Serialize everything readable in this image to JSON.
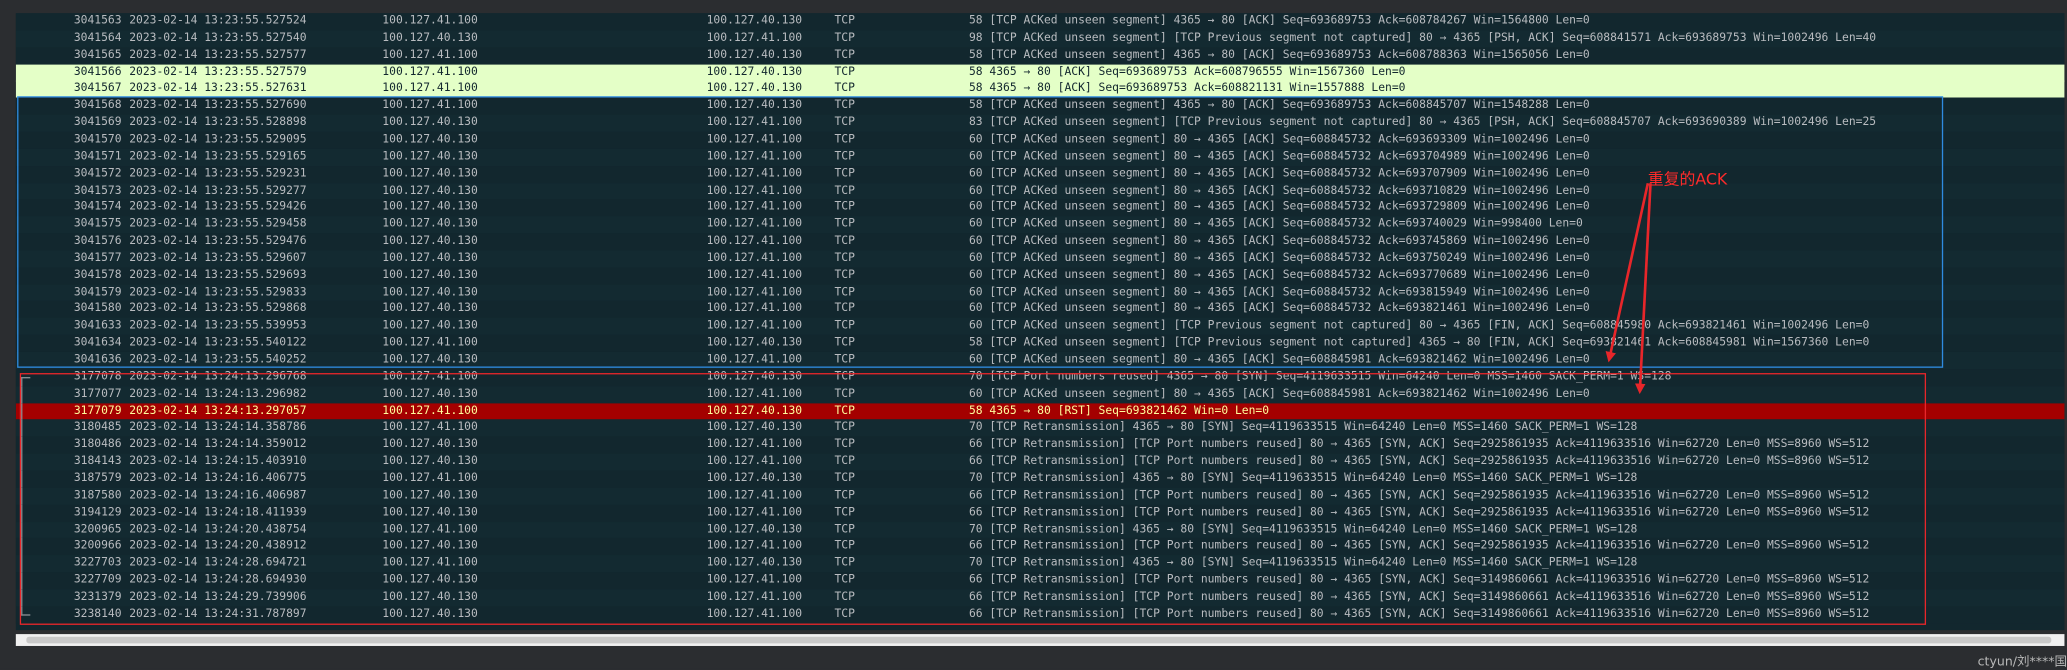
{
  "colors": {
    "list_background": "#12272e",
    "default_text": "#b9bcc0",
    "highlight_row_bg": "#e4ffc7",
    "rst_row_bg": "#a40000",
    "rst_row_text": "#fffc9c",
    "blue_box": "#2f8be0",
    "red_box_and_annotation": "#e8262a"
  },
  "annotation": {
    "label": "重复的ACK"
  },
  "watermark": "ctyun/刘****国",
  "packets": [
    {
      "no": "3041563",
      "time": "2023-02-14 13:23:55.527524",
      "src": "100.127.41.100",
      "dst": "100.127.40.130",
      "proto": "TCP",
      "info": "58 [TCP ACKed unseen segment] 4365 → 80 [ACK] Seq=693689753 Ack=608784267 Win=1564800 Len=0",
      "style": "even",
      "conv": ""
    },
    {
      "no": "3041564",
      "time": "2023-02-14 13:23:55.527540",
      "src": "100.127.40.130",
      "dst": "100.127.41.100",
      "proto": "TCP",
      "info": "98 [TCP ACKed unseen segment] [TCP Previous segment not captured] 80 → 4365 [PSH, ACK] Seq=608841571 Ack=693689753 Win=1002496 Len=40",
      "style": "odd",
      "conv": ""
    },
    {
      "no": "3041565",
      "time": "2023-02-14 13:23:55.527577",
      "src": "100.127.41.100",
      "dst": "100.127.40.130",
      "proto": "TCP",
      "info": "58 [TCP ACKed unseen segment] 4365 → 80 [ACK] Seq=693689753 Ack=608788363 Win=1565056 Len=0",
      "style": "even",
      "conv": ""
    },
    {
      "no": "3041566",
      "time": "2023-02-14 13:23:55.527579",
      "src": "100.127.41.100",
      "dst": "100.127.40.130",
      "proto": "TCP",
      "info": "58 4365 → 80 [ACK] Seq=693689753 Ack=608796555 Win=1567360 Len=0",
      "style": "highlight",
      "conv": ""
    },
    {
      "no": "3041567",
      "time": "2023-02-14 13:23:55.527631",
      "src": "100.127.41.100",
      "dst": "100.127.40.130",
      "proto": "TCP",
      "info": "58 4365 → 80 [ACK] Seq=693689753 Ack=608821131 Win=1557888 Len=0",
      "style": "highlight",
      "conv": ""
    },
    {
      "no": "3041568",
      "time": "2023-02-14 13:23:55.527690",
      "src": "100.127.41.100",
      "dst": "100.127.40.130",
      "proto": "TCP",
      "info": "58 [TCP ACKed unseen segment] 4365 → 80 [ACK] Seq=693689753 Ack=608845707 Win=1548288 Len=0",
      "style": "even",
      "conv": ""
    },
    {
      "no": "3041569",
      "time": "2023-02-14 13:23:55.528898",
      "src": "100.127.40.130",
      "dst": "100.127.41.100",
      "proto": "TCP",
      "info": "83 [TCP ACKed unseen segment] [TCP Previous segment not captured] 80 → 4365 [PSH, ACK] Seq=608845707 Ack=693690389 Win=1002496 Len=25",
      "style": "odd",
      "conv": ""
    },
    {
      "no": "3041570",
      "time": "2023-02-14 13:23:55.529095",
      "src": "100.127.40.130",
      "dst": "100.127.41.100",
      "proto": "TCP",
      "info": "60 [TCP ACKed unseen segment] 80 → 4365 [ACK] Seq=608845732 Ack=693693309 Win=1002496 Len=0",
      "style": "even",
      "conv": ""
    },
    {
      "no": "3041571",
      "time": "2023-02-14 13:23:55.529165",
      "src": "100.127.40.130",
      "dst": "100.127.41.100",
      "proto": "TCP",
      "info": "60 [TCP ACKed unseen segment] 80 → 4365 [ACK] Seq=608845732 Ack=693704989 Win=1002496 Len=0",
      "style": "odd",
      "conv": ""
    },
    {
      "no": "3041572",
      "time": "2023-02-14 13:23:55.529231",
      "src": "100.127.40.130",
      "dst": "100.127.41.100",
      "proto": "TCP",
      "info": "60 [TCP ACKed unseen segment] 80 → 4365 [ACK] Seq=608845732 Ack=693707909 Win=1002496 Len=0",
      "style": "even",
      "conv": ""
    },
    {
      "no": "3041573",
      "time": "2023-02-14 13:23:55.529277",
      "src": "100.127.40.130",
      "dst": "100.127.41.100",
      "proto": "TCP",
      "info": "60 [TCP ACKed unseen segment] 80 → 4365 [ACK] Seq=608845732 Ack=693710829 Win=1002496 Len=0",
      "style": "odd",
      "conv": ""
    },
    {
      "no": "3041574",
      "time": "2023-02-14 13:23:55.529426",
      "src": "100.127.40.130",
      "dst": "100.127.41.100",
      "proto": "TCP",
      "info": "60 [TCP ACKed unseen segment] 80 → 4365 [ACK] Seq=608845732 Ack=693729809 Win=1002496 Len=0",
      "style": "even",
      "conv": ""
    },
    {
      "no": "3041575",
      "time": "2023-02-14 13:23:55.529458",
      "src": "100.127.40.130",
      "dst": "100.127.41.100",
      "proto": "TCP",
      "info": "60 [TCP ACKed unseen segment] 80 → 4365 [ACK] Seq=608845732 Ack=693740029 Win=998400 Len=0",
      "style": "odd",
      "conv": ""
    },
    {
      "no": "3041576",
      "time": "2023-02-14 13:23:55.529476",
      "src": "100.127.40.130",
      "dst": "100.127.41.100",
      "proto": "TCP",
      "info": "60 [TCP ACKed unseen segment] 80 → 4365 [ACK] Seq=608845732 Ack=693745869 Win=1002496 Len=0",
      "style": "even",
      "conv": ""
    },
    {
      "no": "3041577",
      "time": "2023-02-14 13:23:55.529607",
      "src": "100.127.40.130",
      "dst": "100.127.41.100",
      "proto": "TCP",
      "info": "60 [TCP ACKed unseen segment] 80 → 4365 [ACK] Seq=608845732 Ack=693750249 Win=1002496 Len=0",
      "style": "odd",
      "conv": ""
    },
    {
      "no": "3041578",
      "time": "2023-02-14 13:23:55.529693",
      "src": "100.127.40.130",
      "dst": "100.127.41.100",
      "proto": "TCP",
      "info": "60 [TCP ACKed unseen segment] 80 → 4365 [ACK] Seq=608845732 Ack=693770689 Win=1002496 Len=0",
      "style": "even",
      "conv": ""
    },
    {
      "no": "3041579",
      "time": "2023-02-14 13:23:55.529833",
      "src": "100.127.40.130",
      "dst": "100.127.41.100",
      "proto": "TCP",
      "info": "60 [TCP ACKed unseen segment] 80 → 4365 [ACK] Seq=608845732 Ack=693815949 Win=1002496 Len=0",
      "style": "odd",
      "conv": ""
    },
    {
      "no": "3041580",
      "time": "2023-02-14 13:23:55.529868",
      "src": "100.127.40.130",
      "dst": "100.127.41.100",
      "proto": "TCP",
      "info": "60 [TCP ACKed unseen segment] 80 → 4365 [ACK] Seq=608845732 Ack=693821461 Win=1002496 Len=0",
      "style": "even",
      "conv": ""
    },
    {
      "no": "3041633",
      "time": "2023-02-14 13:23:55.539953",
      "src": "100.127.40.130",
      "dst": "100.127.41.100",
      "proto": "TCP",
      "info": "60 [TCP ACKed unseen segment] [TCP Previous segment not captured] 80 → 4365 [FIN, ACK] Seq=608845980 Ack=693821461 Win=1002496 Len=0",
      "style": "odd",
      "conv": ""
    },
    {
      "no": "3041634",
      "time": "2023-02-14 13:23:55.540122",
      "src": "100.127.41.100",
      "dst": "100.127.40.130",
      "proto": "TCP",
      "info": "58 [TCP ACKed unseen segment] [TCP Previous segment not captured] 4365 → 80 [FIN, ACK] Seq=693821461 Ack=608845981 Win=1567360 Len=0",
      "style": "even",
      "conv": ""
    },
    {
      "no": "3041636",
      "time": "2023-02-14 13:23:55.540252",
      "src": "100.127.40.130",
      "dst": "100.127.41.100",
      "proto": "TCP",
      "info": "60 [TCP ACKed unseen segment] 80 → 4365 [ACK] Seq=608845981 Ack=693821462 Win=1002496 Len=0",
      "style": "odd",
      "conv": ""
    },
    {
      "no": "3177078",
      "time": "2023-02-14 13:24:13.296768",
      "src": "100.127.41.100",
      "dst": "100.127.40.130",
      "proto": "TCP",
      "info": "70 [TCP Port numbers reused] 4365 → 80 [SYN] Seq=4119633515 Win=64240 Len=0 MSS=1460 SACK_PERM=1 WS=128",
      "style": "even",
      "conv": "start"
    },
    {
      "no": "3177077",
      "time": "2023-02-14 13:24:13.296982",
      "src": "100.127.40.130",
      "dst": "100.127.41.100",
      "proto": "TCP",
      "info": "60 [TCP ACKed unseen segment] 80 → 4365 [ACK] Seq=608845981 Ack=693821462 Win=1002496 Len=0",
      "style": "odd",
      "conv": "line"
    },
    {
      "no": "3177079",
      "time": "2023-02-14 13:24:13.297057",
      "src": "100.127.41.100",
      "dst": "100.127.40.130",
      "proto": "TCP",
      "info": "58 4365 → 80 [RST] Seq=693821462 Win=0 Len=0",
      "style": "rst",
      "conv": "line"
    },
    {
      "no": "3180485",
      "time": "2023-02-14 13:24:14.358786",
      "src": "100.127.41.100",
      "dst": "100.127.40.130",
      "proto": "TCP",
      "info": "70 [TCP Retransmission] 4365 → 80 [SYN] Seq=4119633515 Win=64240 Len=0 MSS=1460 SACK_PERM=1 WS=128",
      "style": "odd",
      "conv": "line"
    },
    {
      "no": "3180486",
      "time": "2023-02-14 13:24:14.359012",
      "src": "100.127.40.130",
      "dst": "100.127.41.100",
      "proto": "TCP",
      "info": "66 [TCP Retransmission] [TCP Port numbers reused] 80 → 4365 [SYN, ACK] Seq=2925861935 Ack=4119633516 Win=62720 Len=0 MSS=8960 WS=512",
      "style": "even",
      "conv": "line"
    },
    {
      "no": "3184143",
      "time": "2023-02-14 13:24:15.403910",
      "src": "100.127.40.130",
      "dst": "100.127.41.100",
      "proto": "TCP",
      "info": "66 [TCP Retransmission] [TCP Port numbers reused] 80 → 4365 [SYN, ACK] Seq=2925861935 Ack=4119633516 Win=62720 Len=0 MSS=8960 WS=512",
      "style": "odd",
      "conv": "line"
    },
    {
      "no": "3187579",
      "time": "2023-02-14 13:24:16.406775",
      "src": "100.127.41.100",
      "dst": "100.127.40.130",
      "proto": "TCP",
      "info": "70 [TCP Retransmission] 4365 → 80 [SYN] Seq=4119633515 Win=64240 Len=0 MSS=1460 SACK_PERM=1 WS=128",
      "style": "even",
      "conv": "line"
    },
    {
      "no": "3187580",
      "time": "2023-02-14 13:24:16.406987",
      "src": "100.127.40.130",
      "dst": "100.127.41.100",
      "proto": "TCP",
      "info": "66 [TCP Retransmission] [TCP Port numbers reused] 80 → 4365 [SYN, ACK] Seq=2925861935 Ack=4119633516 Win=62720 Len=0 MSS=8960 WS=512",
      "style": "odd",
      "conv": "line"
    },
    {
      "no": "3194129",
      "time": "2023-02-14 13:24:18.411939",
      "src": "100.127.40.130",
      "dst": "100.127.41.100",
      "proto": "TCP",
      "info": "66 [TCP Retransmission] [TCP Port numbers reused] 80 → 4365 [SYN, ACK] Seq=2925861935 Ack=4119633516 Win=62720 Len=0 MSS=8960 WS=512",
      "style": "even",
      "conv": "line"
    },
    {
      "no": "3200965",
      "time": "2023-02-14 13:24:20.438754",
      "src": "100.127.41.100",
      "dst": "100.127.40.130",
      "proto": "TCP",
      "info": "70 [TCP Retransmission] 4365 → 80 [SYN] Seq=4119633515 Win=64240 Len=0 MSS=1460 SACK_PERM=1 WS=128",
      "style": "odd",
      "conv": "line"
    },
    {
      "no": "3200966",
      "time": "2023-02-14 13:24:20.438912",
      "src": "100.127.40.130",
      "dst": "100.127.41.100",
      "proto": "TCP",
      "info": "66 [TCP Retransmission] [TCP Port numbers reused] 80 → 4365 [SYN, ACK] Seq=2925861935 Ack=4119633516 Win=62720 Len=0 MSS=8960 WS=512",
      "style": "even",
      "conv": "line"
    },
    {
      "no": "3227703",
      "time": "2023-02-14 13:24:28.694721",
      "src": "100.127.41.100",
      "dst": "100.127.40.130",
      "proto": "TCP",
      "info": "70 [TCP Retransmission] 4365 → 80 [SYN] Seq=4119633515 Win=64240 Len=0 MSS=1460 SACK_PERM=1 WS=128",
      "style": "odd",
      "conv": "line"
    },
    {
      "no": "3227709",
      "time": "2023-02-14 13:24:28.694930",
      "src": "100.127.40.130",
      "dst": "100.127.41.100",
      "proto": "TCP",
      "info": "66 [TCP Retransmission] [TCP Port numbers reused] 80 → 4365 [SYN, ACK] Seq=3149860661 Ack=4119633516 Win=62720 Len=0 MSS=8960 WS=512",
      "style": "even",
      "conv": "line"
    },
    {
      "no": "3231379",
      "time": "2023-02-14 13:24:29.739906",
      "src": "100.127.40.130",
      "dst": "100.127.41.100",
      "proto": "TCP",
      "info": "66 [TCP Retransmission] [TCP Port numbers reused] 80 → 4365 [SYN, ACK] Seq=3149860661 Ack=4119633516 Win=62720 Len=0 MSS=8960 WS=512",
      "style": "odd",
      "conv": "line"
    },
    {
      "no": "3238140",
      "time": "2023-02-14 13:24:31.787897",
      "src": "100.127.40.130",
      "dst": "100.127.41.100",
      "proto": "TCP",
      "info": "66 [TCP Retransmission] [TCP Port numbers reused] 80 → 4365 [SYN, ACK] Seq=3149860661 Ack=4119633516 Win=62720 Len=0 MSS=8960 WS=512",
      "style": "even",
      "conv": "end"
    }
  ]
}
